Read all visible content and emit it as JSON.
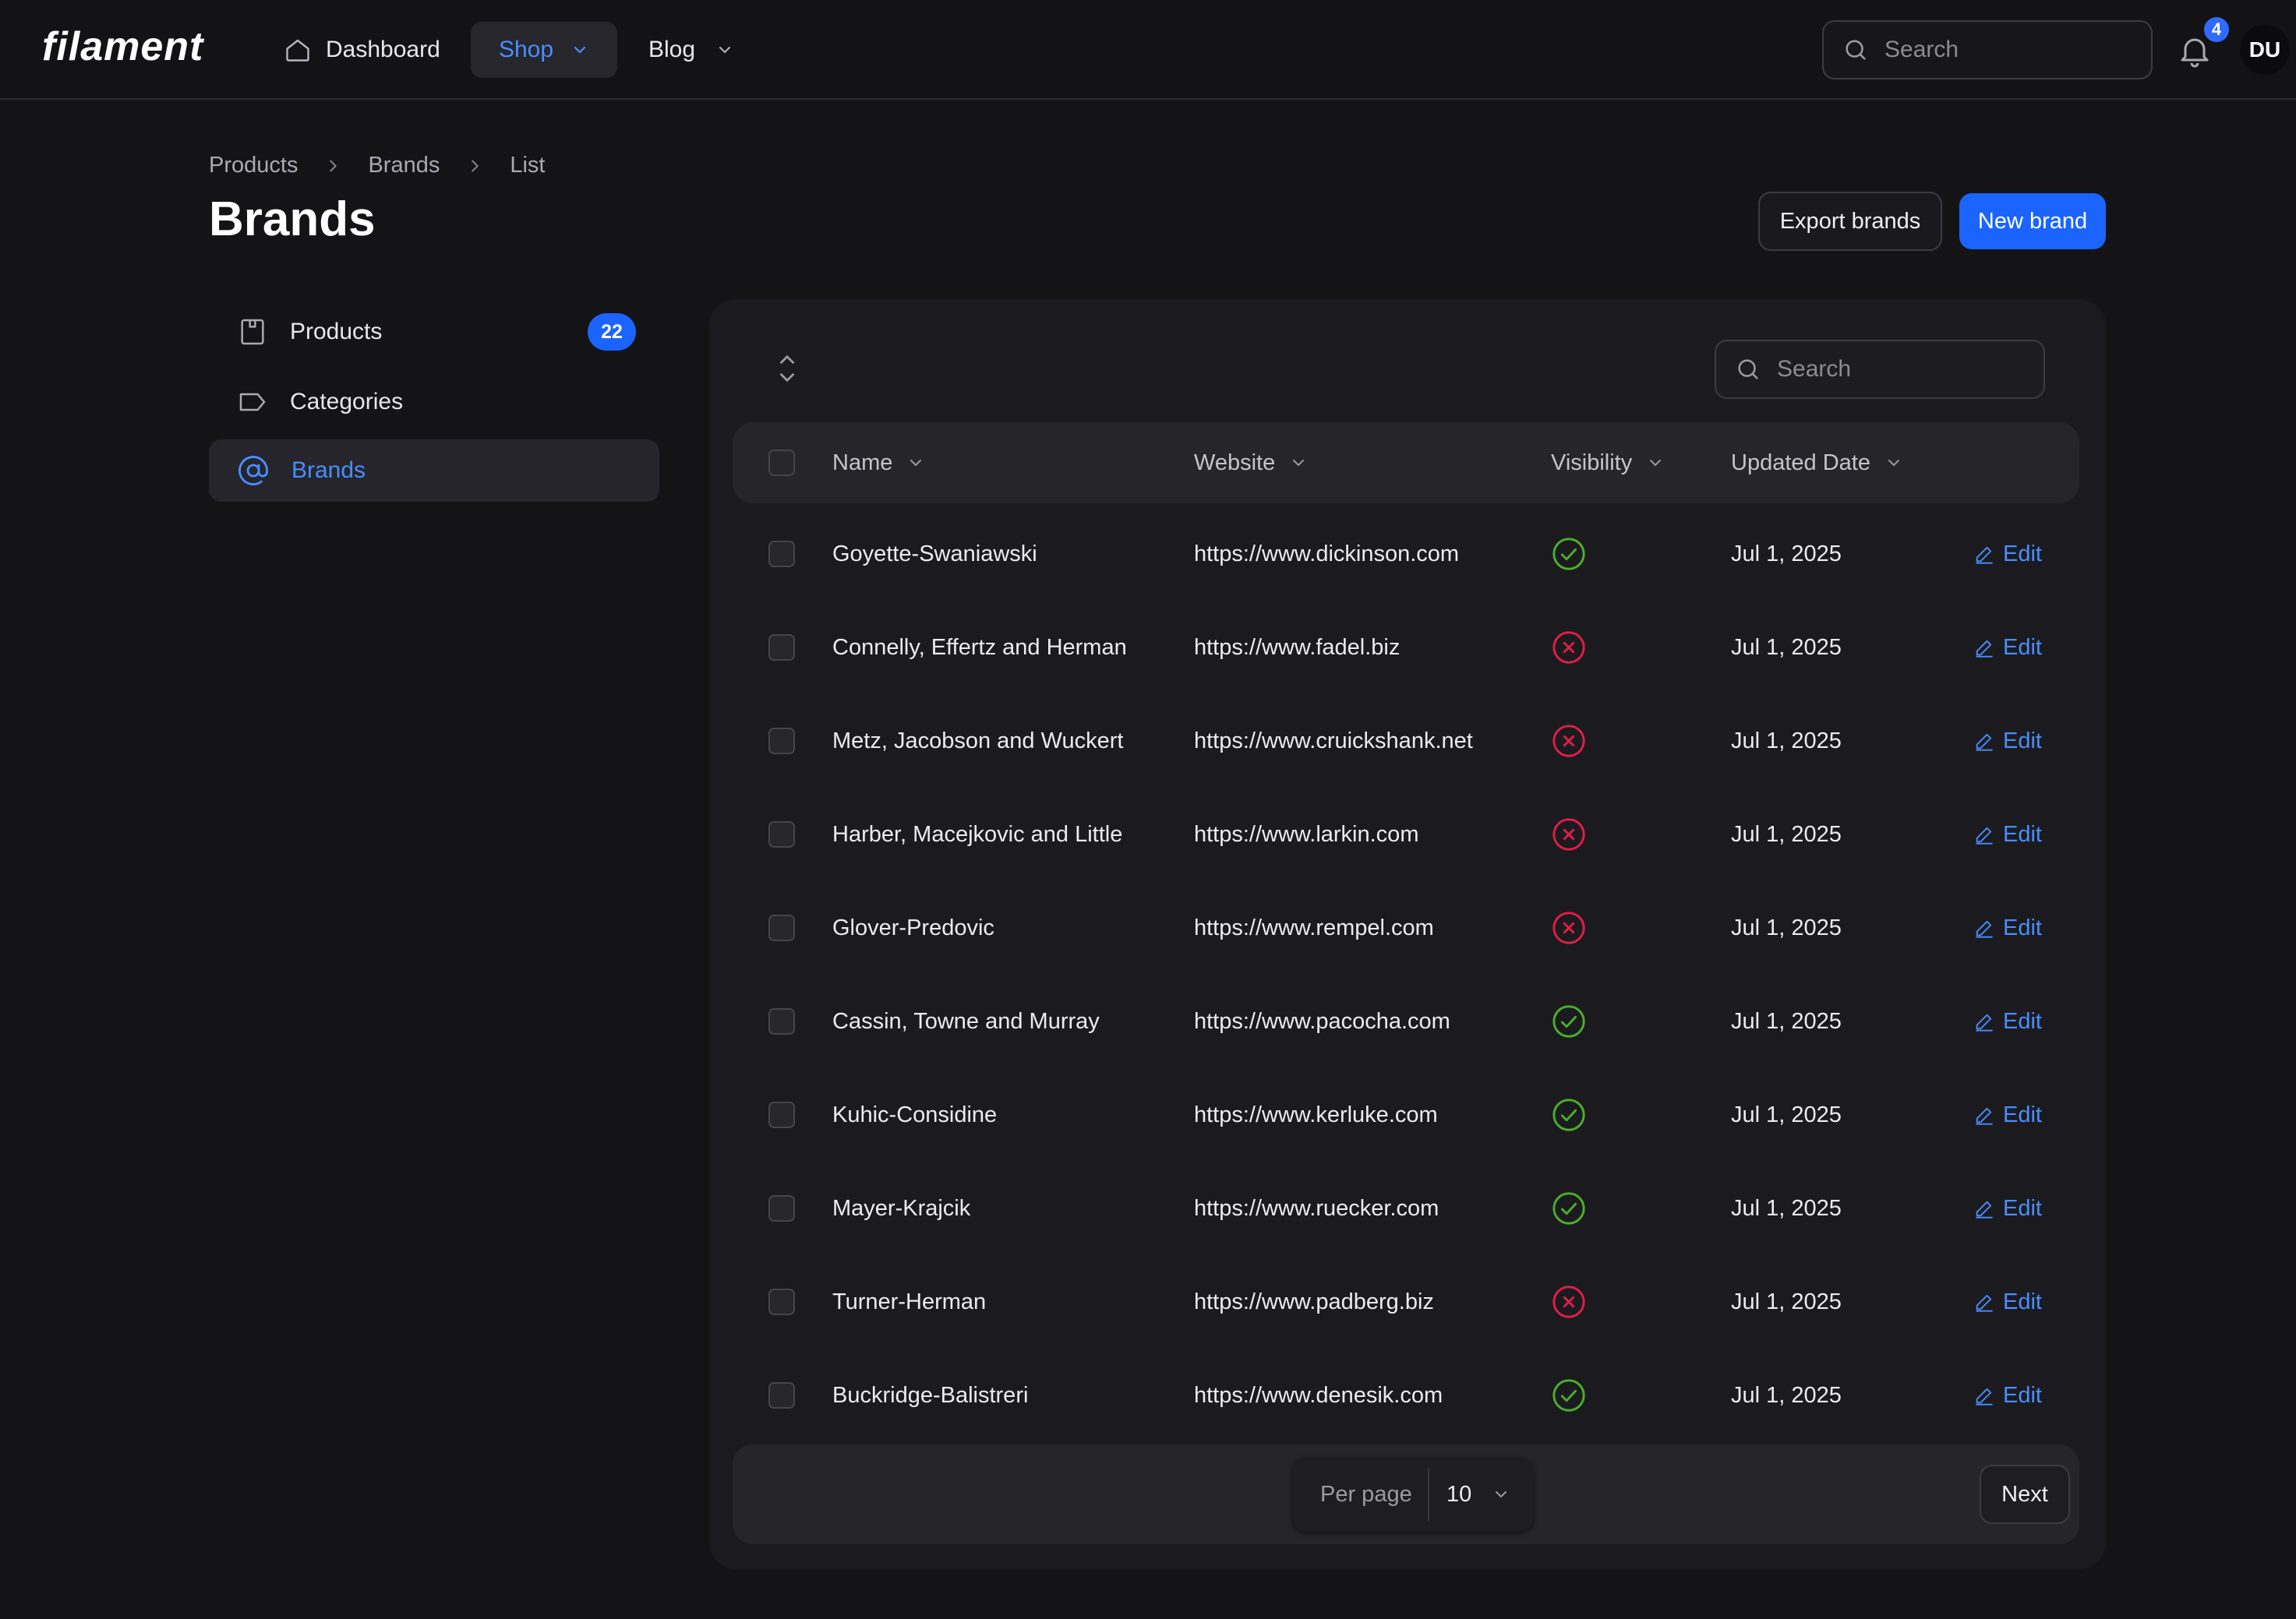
{
  "app": {
    "logo": "filament"
  },
  "topnav": {
    "dashboard": "Dashboard",
    "shop": "Shop",
    "blog": "Blog",
    "search_placeholder": "Search",
    "notification_count": "4",
    "avatar_initials": "DU"
  },
  "breadcrumb": [
    "Products",
    "Brands",
    "List"
  ],
  "page": {
    "title": "Brands",
    "export_label": "Export brands",
    "new_label": "New brand"
  },
  "sidebar": {
    "items": [
      {
        "label": "Products",
        "icon": "product-box-icon",
        "badge": "22",
        "active": false
      },
      {
        "label": "Categories",
        "icon": "tag-icon",
        "active": false
      },
      {
        "label": "Brands",
        "icon": "at-sign-icon",
        "active": true
      }
    ]
  },
  "table": {
    "search_placeholder": "Search",
    "columns": [
      "Name",
      "Website",
      "Visibility",
      "Updated Date"
    ],
    "edit_label": "Edit",
    "rows": [
      {
        "name": "Goyette-Swaniawski",
        "website": "https://www.dickinson.com",
        "visible": true,
        "updated": "Jul 1, 2025"
      },
      {
        "name": "Connelly, Effertz and Herman",
        "website": "https://www.fadel.biz",
        "visible": false,
        "updated": "Jul 1, 2025"
      },
      {
        "name": "Metz, Jacobson and Wuckert",
        "website": "https://www.cruickshank.net",
        "visible": false,
        "updated": "Jul 1, 2025"
      },
      {
        "name": "Harber, Macejkovic and Little",
        "website": "https://www.larkin.com",
        "visible": false,
        "updated": "Jul 1, 2025"
      },
      {
        "name": "Glover-Predovic",
        "website": "https://www.rempel.com",
        "visible": false,
        "updated": "Jul 1, 2025"
      },
      {
        "name": "Cassin, Towne and Murray",
        "website": "https://www.pacocha.com",
        "visible": true,
        "updated": "Jul 1, 2025"
      },
      {
        "name": "Kuhic-Considine",
        "website": "https://www.kerluke.com",
        "visible": true,
        "updated": "Jul 1, 2025"
      },
      {
        "name": "Mayer-Krajcik",
        "website": "https://www.ruecker.com",
        "visible": true,
        "updated": "Jul 1, 2025"
      },
      {
        "name": "Turner-Herman",
        "website": "https://www.padberg.biz",
        "visible": false,
        "updated": "Jul 1, 2025"
      },
      {
        "name": "Buckridge-Balistreri",
        "website": "https://www.denesik.com",
        "visible": true,
        "updated": "Jul 1, 2025"
      }
    ]
  },
  "pagination": {
    "per_page_label": "Per page",
    "per_page_value": "10",
    "next_label": "Next"
  },
  "colors": {
    "accent": "#1b64ff",
    "link": "#4a8dff",
    "visible_ok": "#4caf2a",
    "visible_no": "#e11d48",
    "background": "#141417"
  }
}
